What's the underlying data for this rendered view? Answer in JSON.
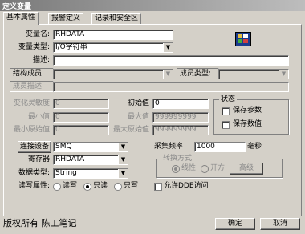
{
  "window": {
    "title": "定义变量"
  },
  "tabs": [
    {
      "label": "基本属性"
    },
    {
      "label": "报警定义"
    },
    {
      "label": "记录和安全区"
    }
  ],
  "basic": {
    "var_name_label": "变量名:",
    "var_name_value": "RHDATA",
    "var_type_label": "变量类型:",
    "var_type_value": "I/O字符串",
    "desc_label": "描述:",
    "desc_value": "",
    "struct_member_label": "结构成员:",
    "member_type_label": "成员类型:",
    "member_desc_label": "成员描述:"
  },
  "range": {
    "sensitivity_label": "变化灵敏度",
    "sensitivity_value": "0",
    "min_label": "最小值",
    "min_value": "0",
    "min_raw_label": "最小原始值",
    "min_raw_value": "0",
    "init_label": "初始值",
    "init_value": "0",
    "max_label": "最大值",
    "max_value": "999999999",
    "max_raw_label": "最大原始值",
    "max_raw_value": "999999999"
  },
  "state": {
    "title": "状态",
    "keep_params": "保存参数",
    "keep_values": "保存数值"
  },
  "io": {
    "connect_device_button": "连接设备",
    "device_value": "SMQ",
    "register_label": "寄存器",
    "register_value": "RHDATA",
    "data_type_label": "数据类型:",
    "data_type_value": "String",
    "rw_label": "读写属性:",
    "rw_options": [
      "读写",
      "只读",
      "只写"
    ],
    "rw_selected": "只读",
    "sample_label": "采集频率",
    "sample_value": "1000",
    "sample_unit": "毫秒",
    "convert_title": "转换方式",
    "convert_options": [
      "线性",
      "开方"
    ],
    "convert_selected": "线性",
    "advanced_button": "高级",
    "allow_dde": "允许DDE访问"
  },
  "footer": {
    "watermark": "版权所有 陈工笔记",
    "ok_button": "确定",
    "cancel_button": "取消"
  }
}
